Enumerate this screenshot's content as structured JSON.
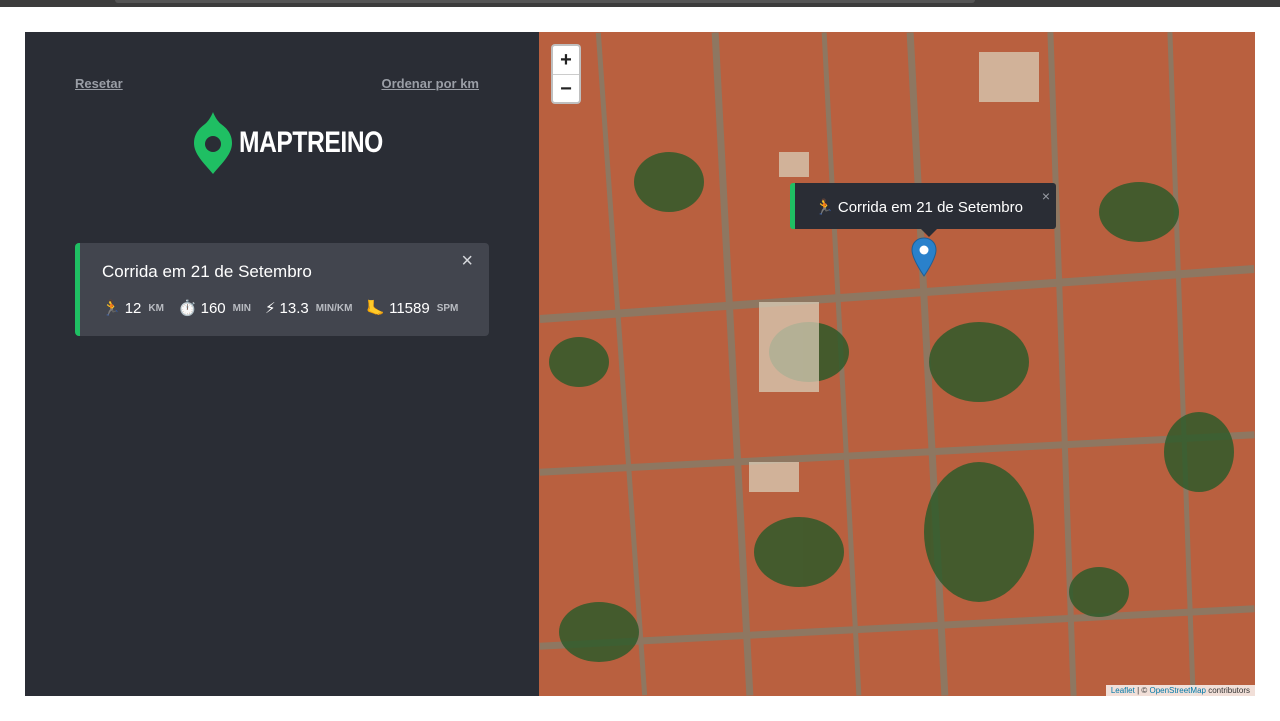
{
  "sidebar": {
    "reset_label": "Resetar",
    "sort_label": "Ordenar por km",
    "logo_text": "MAPTREINO",
    "accent_color": "#1fbf63"
  },
  "card": {
    "title": "Corrida em 21 de Setembro",
    "stats": [
      {
        "icon": "🏃",
        "value": "12",
        "unit": "KM"
      },
      {
        "icon": "⏱️",
        "value": "160",
        "unit": "MIN"
      },
      {
        "icon": "⚡",
        "value": "13.3",
        "unit": "MIN/KM"
      },
      {
        "icon": "🦶",
        "value": "11589",
        "unit": "SPM"
      }
    ]
  },
  "map": {
    "zoom_in": "+",
    "zoom_out": "−",
    "popup_icon": "🏃",
    "popup_text": "Corrida em 21 de Setembro",
    "attribution_leaflet": "Leaflet",
    "attribution_sep": " | © ",
    "attribution_osm": "OpenStreetMap",
    "attribution_tail": " contributors",
    "marker_color": "#2a81cb"
  },
  "icons": {
    "close": "×",
    "logo_pin": "map-pin-icon"
  }
}
